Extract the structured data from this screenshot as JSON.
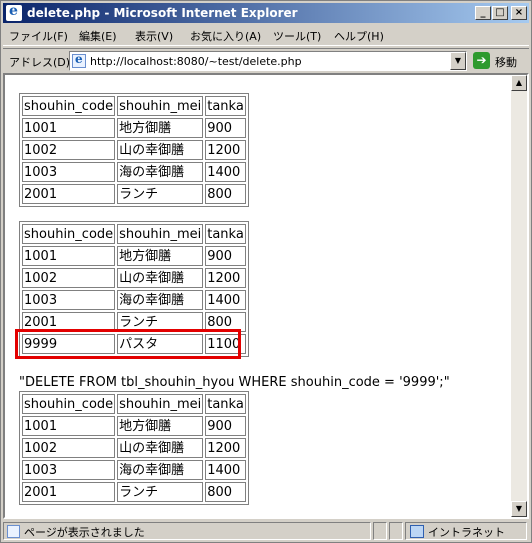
{
  "window": {
    "title": "delete.php - Microsoft Internet Explorer",
    "minimize": "_",
    "maximize": "□",
    "close": "×"
  },
  "menu": [
    "ファイル(F)",
    "編集(E)",
    "表示(V)",
    "お気に入り(A)",
    "ツール(T)",
    "ヘルプ(H)"
  ],
  "address": {
    "label": "アドレス(D)",
    "value": "http://localhost:8080/~test/delete.php",
    "go_label": "移動"
  },
  "headers": [
    "shouhin_code",
    "shouhin_mei",
    "tanka"
  ],
  "table1": [
    [
      "1001",
      "地方御膳",
      "900"
    ],
    [
      "1002",
      "山の幸御膳",
      "1200"
    ],
    [
      "1003",
      "海の幸御膳",
      "1400"
    ],
    [
      "2001",
      "ランチ",
      "800"
    ]
  ],
  "table2": [
    [
      "1001",
      "地方御膳",
      "900"
    ],
    [
      "1002",
      "山の幸御膳",
      "1200"
    ],
    [
      "1003",
      "海の幸御膳",
      "1400"
    ],
    [
      "2001",
      "ランチ",
      "800"
    ],
    [
      "9999",
      "パスタ",
      "1100"
    ]
  ],
  "sql": "\"DELETE FROM tbl_shouhin_hyou WHERE shouhin_code = '9999';\"",
  "table3": [
    [
      "1001",
      "地方御膳",
      "900"
    ],
    [
      "1002",
      "山の幸御膳",
      "1200"
    ],
    [
      "1003",
      "海の幸御膳",
      "1400"
    ],
    [
      "2001",
      "ランチ",
      "800"
    ]
  ],
  "status": {
    "text": "ページが表示されました",
    "zone": "イントラネット"
  },
  "colors": {
    "highlight": "#e30000",
    "titlebar_start": "#0a246a",
    "titlebar_end": "#a6caf0"
  }
}
